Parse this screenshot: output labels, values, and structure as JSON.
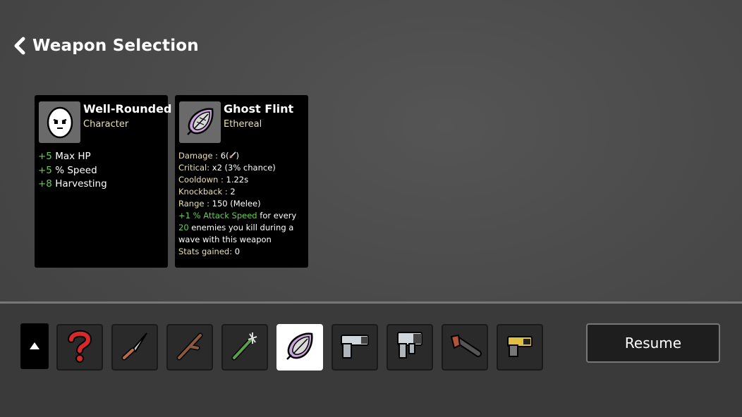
{
  "header": {
    "title": "Weapon Selection",
    "back_icon": "chevron-left-icon"
  },
  "character_card": {
    "name": "Well-Rounded",
    "type": "Character",
    "icon": "egg-face-icon",
    "stats": [
      {
        "value": "+5",
        "label": "Max HP"
      },
      {
        "value": "+5",
        "label": "% Speed"
      },
      {
        "value": "+8",
        "label": "Harvesting"
      }
    ]
  },
  "weapon_card": {
    "name": "Ghost Flint",
    "type": "Ethereal",
    "icon": "ghost-flint-icon",
    "damage_label": "Damage :",
    "damage_value": "6(",
    "damage_close": ")",
    "critical_label": "Critical:",
    "critical_value": "x2 (3% chance)",
    "cooldown_label": "Cooldown :",
    "cooldown_value": "1.22s",
    "knockback_label": "Knockback :",
    "knockback_value": "2",
    "range_label": "Range :",
    "range_value": "150 (Melee)",
    "effect_amount": "+1",
    "effect_stat": "% Attack Speed",
    "effect_text_1": "for every",
    "effect_count": "20",
    "effect_text_2": "enemies you kill during a wave with this weapon",
    "gained_label": "Stats gained:",
    "gained_value": "0"
  },
  "toolbar": {
    "scroll_icon": "triangle-up-icon",
    "slots": [
      {
        "icon": "question-mark-icon"
      },
      {
        "icon": "knife-icon"
      },
      {
        "icon": "stick-icon"
      },
      {
        "icon": "spiked-stick-icon"
      },
      {
        "icon": "ghost-flint-icon",
        "selected": true
      },
      {
        "icon": "pistol-icon"
      },
      {
        "icon": "smg-icon"
      },
      {
        "icon": "double-barrel-shotgun-icon"
      },
      {
        "icon": "taser-icon"
      }
    ],
    "resume_label": "Resume"
  },
  "colors": {
    "bonus_green": "#5fd34a",
    "subtitle_tan": "#e8e0b0",
    "flint_purple": "#c9a3d9"
  }
}
